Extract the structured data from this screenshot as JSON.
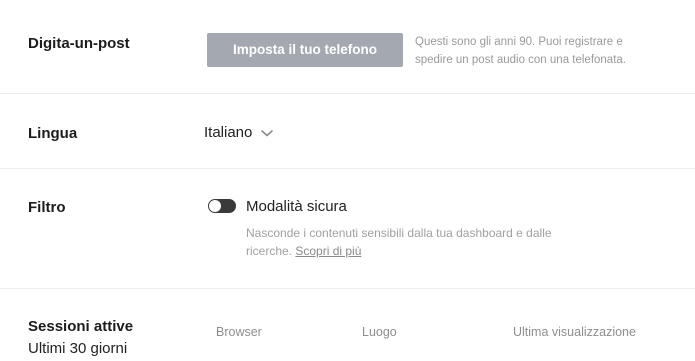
{
  "post_by_phone": {
    "label": "Digita-un-post",
    "button_label": "Imposta il tuo telefono",
    "description_line1": "Questi sono gli anni 90. Puoi registrare e",
    "description_line2": "spedire un post audio con una telefonata."
  },
  "language": {
    "label": "Lingua",
    "selected": "Italiano",
    "icon": "chevron-down-icon"
  },
  "filter": {
    "label": "Filtro",
    "toggle_label": "Modalità sicura",
    "toggle_on": false,
    "description_line1": "Nasconde i contenuti sensibili dalla tua dashboard e dalle",
    "description_line2_prefix": "ricerche.",
    "description_link": "Scopri di più"
  },
  "sessions": {
    "label": "Sessioni attive",
    "sublabel": "Ultimi 30 giorni",
    "columns": [
      "Browser",
      "Luogo",
      "Ultima visualizzazione"
    ]
  },
  "colors": {
    "button_bg": "#a4a8b0",
    "muted_text": "#9a9a9a",
    "divider": "#ededed"
  }
}
